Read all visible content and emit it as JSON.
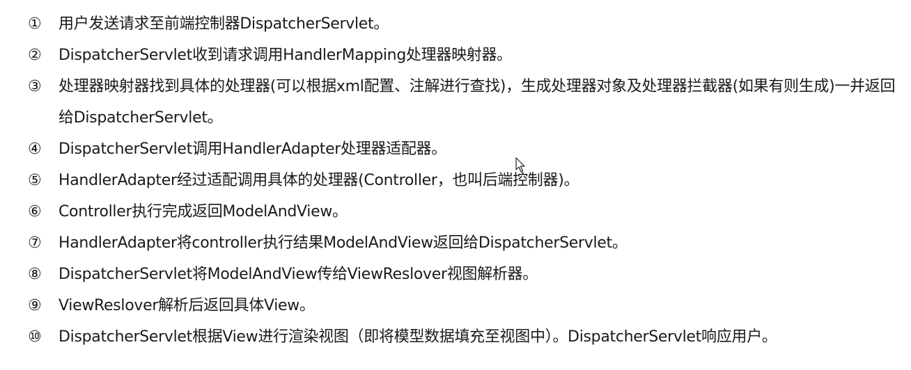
{
  "steps": [
    {
      "num": "①",
      "text": "用户发送请求至前端控制器DispatcherServlet。"
    },
    {
      "num": "②",
      "text": "DispatcherServlet收到请求调用HandlerMapping处理器映射器。"
    },
    {
      "num": "③",
      "text": "处理器映射器找到具体的处理器(可以根据xml配置、注解进行查找)，生成处理器对象及处理器拦截器(如果有则生成)一并返回给DispatcherServlet。"
    },
    {
      "num": "④",
      "text": "DispatcherServlet调用HandlerAdapter处理器适配器。"
    },
    {
      "num": "⑤",
      "text": "HandlerAdapter经过适配调用具体的处理器(Controller，也叫后端控制器)。"
    },
    {
      "num": "⑥",
      "text": "Controller执行完成返回ModelAndView。"
    },
    {
      "num": "⑦",
      "text": "HandlerAdapter将controller执行结果ModelAndView返回给DispatcherServlet。"
    },
    {
      "num": "⑧",
      "text": "DispatcherServlet将ModelAndView传给ViewReslover视图解析器。"
    },
    {
      "num": "⑨",
      "text": "ViewReslover解析后返回具体View。"
    },
    {
      "num": "⑩",
      "text": "DispatcherServlet根据View进行渲染视图（即将模型数据填充至视图中）。DispatcherServlet响应用户。"
    }
  ],
  "icons": {
    "cursor": "mouse-pointer-icon"
  }
}
